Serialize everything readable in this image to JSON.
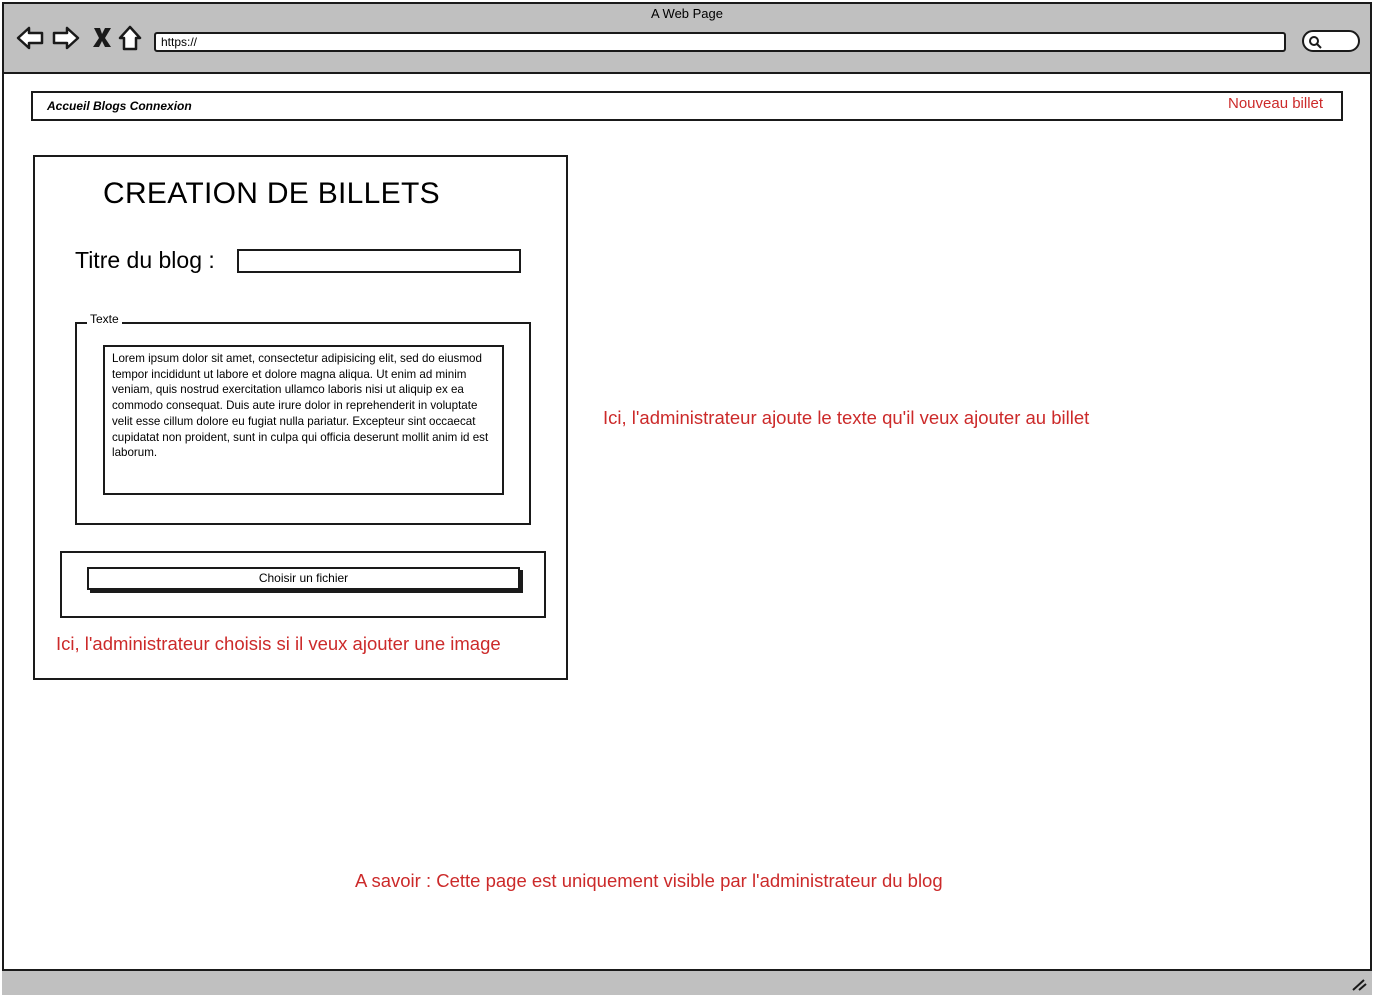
{
  "window": {
    "title": "A Web Page",
    "url": "https://"
  },
  "nav": {
    "links": "Accueil Blogs Connexion",
    "new_post": "Nouveau billet"
  },
  "form": {
    "heading": "CREATION DE BILLETS",
    "blog_title_label": "Titre du blog :",
    "blog_title_value": "",
    "text_legend": "Texte",
    "text_body": "Lorem ipsum dolor sit amet, consectetur adipisicing elit, sed do eiusmod tempor incididunt ut labore et dolore magna aliqua. Ut enim ad minim veniam, quis nostrud exercitation ullamco laboris nisi ut aliquip ex ea commodo consequat. Duis aute irure dolor in reprehenderit in voluptate velit esse cillum dolore eu fugiat nulla pariatur. Excepteur sint occaecat cupidatat non proident, sunt in culpa qui officia deserunt mollit anim id est laborum.",
    "file_button": "Choisir un fichier"
  },
  "notes": {
    "image": "Ici, l'administrateur choisis si il veux ajouter une image",
    "text": "Ici, l'administrateur ajoute le texte qu'il veux ajouter au billet",
    "admin_only": "A savoir : Cette page est uniquement visible par l'administrateur du blog"
  },
  "icons": {
    "back": "back-arrow-icon",
    "forward": "forward-arrow-icon",
    "stop": "close-icon",
    "home": "home-icon",
    "search": "search-icon",
    "resize": "resize-grip-icon"
  },
  "colors": {
    "annotation": "#cc2a2a",
    "chrome": "#c0c0c0",
    "stroke": "#1a1a1a"
  }
}
